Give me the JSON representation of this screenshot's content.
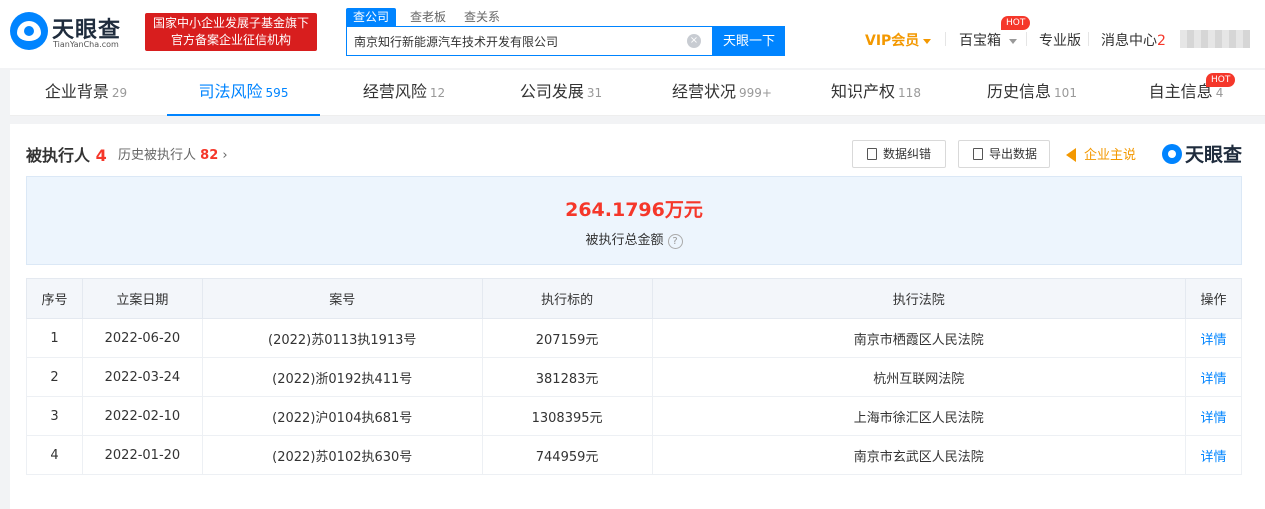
{
  "header": {
    "logo_text": "天眼查",
    "logo_sub": "TianYanCha.com",
    "promo_line1": "国家中小企业发展子基金旗下",
    "promo_line2": "官方备案企业征信机构",
    "search_tabs": [
      "查公司",
      "查老板",
      "查关系"
    ],
    "search_value": "南京知行新能源汽车技术开发有限公司",
    "search_button": "天眼一下",
    "vip": "VIP会员",
    "treasure": "百宝箱",
    "hot": "HOT",
    "pro": "专业版",
    "messages": "消息中心",
    "messages_count": "2"
  },
  "tabs": [
    {
      "label": "企业背景",
      "count": "29"
    },
    {
      "label": "司法风险",
      "count": "595"
    },
    {
      "label": "经营风险",
      "count": "12"
    },
    {
      "label": "公司发展",
      "count": "31"
    },
    {
      "label": "经营状况",
      "count": "999+"
    },
    {
      "label": "知识产权",
      "count": "118"
    },
    {
      "label": "历史信息",
      "count": "101"
    },
    {
      "label": "自主信息",
      "count": "4"
    }
  ],
  "section": {
    "title": "被执行人",
    "count": "4",
    "history_label": "历史被执行人",
    "history_count": "82",
    "chevron": "›",
    "correct_button": "数据纠错",
    "export_button": "导出数据",
    "owner_label": "企业主说",
    "brand": "天眼查"
  },
  "summary": {
    "amount": "264.1796万元",
    "label": "被执行总金额",
    "help": "?"
  },
  "table": {
    "headers": [
      "序号",
      "立案日期",
      "案号",
      "执行标的",
      "执行法院",
      "操作"
    ],
    "rows": [
      [
        "1",
        "2022-06-20",
        "(2022)苏0113执1913号",
        "207159元",
        "南京市栖霞区人民法院",
        "详情"
      ],
      [
        "2",
        "2022-03-24",
        "(2022)浙0192执411号",
        "381283元",
        "杭州互联网法院",
        "详情"
      ],
      [
        "3",
        "2022-02-10",
        "(2022)沪0104执681号",
        "1308395元",
        "上海市徐汇区人民法院",
        "详情"
      ],
      [
        "4",
        "2022-01-20",
        "(2022)苏0102执630号",
        "744959元",
        "南京市玄武区人民法院",
        "详情"
      ]
    ]
  }
}
